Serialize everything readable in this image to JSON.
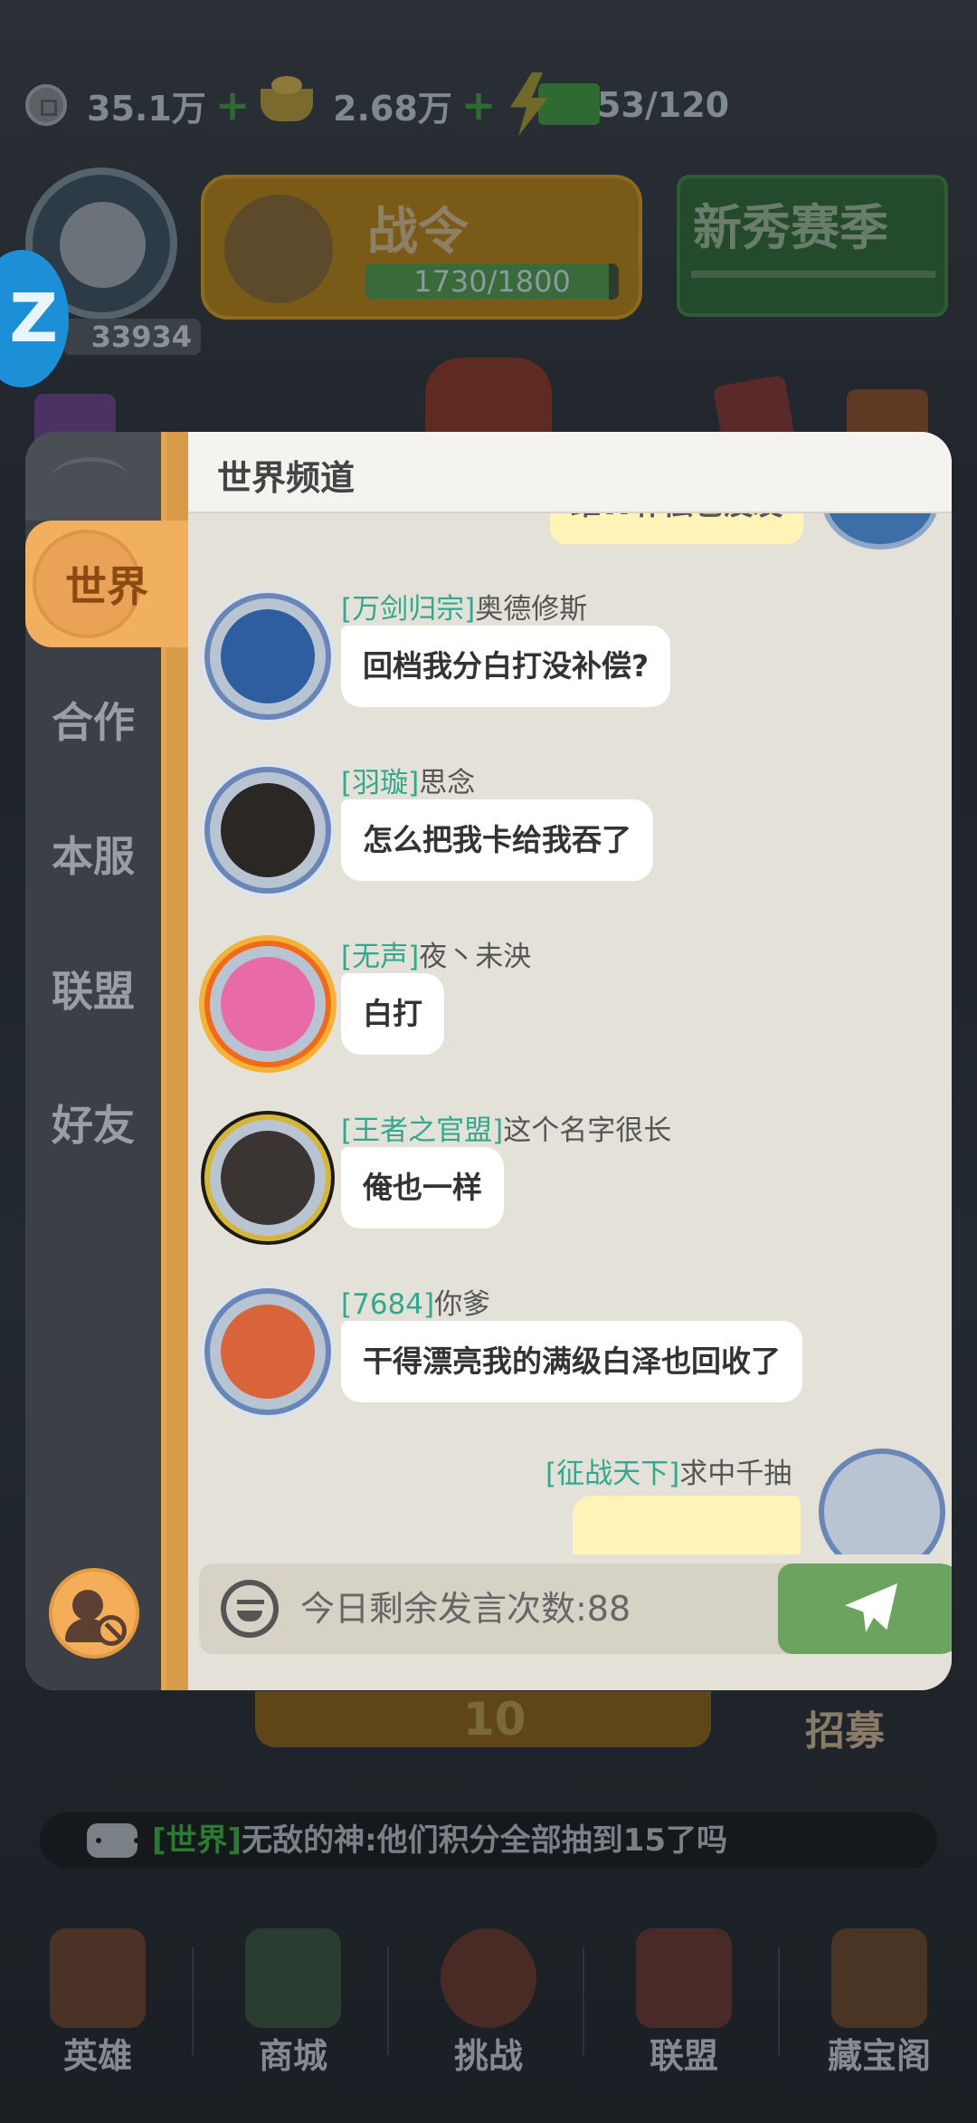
{
  "hud": {
    "copper": "35.1万",
    "gold": "2.68万",
    "energy": "53/120",
    "plus": "+"
  },
  "player": {
    "power": "33934",
    "z_badge": "Z"
  },
  "banners": {
    "battle_pass_title": "战令",
    "battle_pass_progress": "1730/1800",
    "battle_pass_fill": 0.96,
    "season_title": "新秀赛季"
  },
  "chat": {
    "header_title": "世界频道",
    "tabs": [
      "世界",
      "合作",
      "本服",
      "联盟",
      "好友"
    ],
    "active_tab": "世界",
    "top_peek_text": "维W补偿也没发",
    "messages": [
      {
        "guild": "[万剑归宗]",
        "name": "奥德修斯",
        "text": "回档我分白打没补偿?"
      },
      {
        "guild": "[羽璇]",
        "name": "思念",
        "text": "怎么把我卡给我吞了"
      },
      {
        "guild": "[无声]",
        "name": "夜丶未泱",
        "text": "白打"
      },
      {
        "guild": "[王者之官盟]",
        "name": "这个名字很长",
        "text": "俺也一样"
      },
      {
        "guild": "[7684]",
        "name": "你爹",
        "text": "干得漂亮我的满级白泽也回收了"
      }
    ],
    "self_message": {
      "guild": "[征战天下]",
      "name": "求中千抽"
    },
    "input_placeholder": "今日剩余发言次数:88"
  },
  "behind": {
    "cost": "10",
    "recruit": "招募"
  },
  "ticker": {
    "tag": "[世界]",
    "text": "无敌的神:他们积分全部抽到15了吗"
  },
  "nav": [
    "英雄",
    "商城",
    "挑战",
    "联盟",
    "藏宝阁"
  ]
}
